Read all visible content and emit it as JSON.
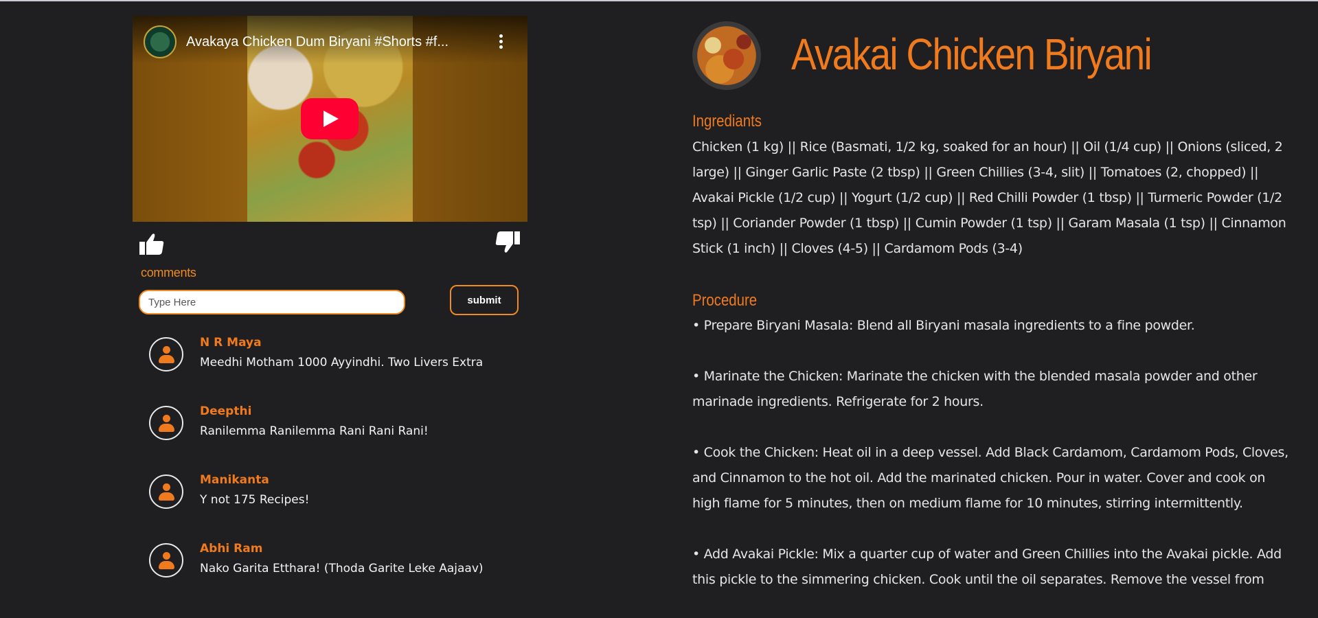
{
  "video": {
    "title": "Avakaya Chicken Dum Biryani #Shorts #f..."
  },
  "comments_section": {
    "label": "comments",
    "input_placeholder": "Type Here",
    "submit_label": "submit",
    "items": [
      {
        "name": "N R Maya",
        "text": "Meedhi Motham 1000 Ayyindhi. Two Livers Extra"
      },
      {
        "name": "Deepthi",
        "text": "Ranilemma Ranilemma Rani Rani Rani!"
      },
      {
        "name": "Manikanta",
        "text": "Y not 175 Recipes!"
      },
      {
        "name": "Abhi Ram",
        "text": "Nako Garita Etthara! (Thoda Garite Leke Aajaav)"
      }
    ]
  },
  "recipe": {
    "title": "Avakai Chicken Biryani",
    "ingredients_heading": "Ingrediants",
    "ingredients": "Chicken (1 kg) || Rice (Basmati, 1/2 kg, soaked for an hour) || Oil (1/4 cup) || Onions (sliced, 2 large) || Ginger Garlic Paste (2 tbsp) || Green Chillies (3-4, slit) || Tomatoes (2, chopped) || Avakai Pickle (1/2 cup) || Yogurt (1/2 cup) || Red Chilli Powder (1 tbsp) || Turmeric Powder (1/2 tsp) || Coriander Powder (1 tbsp) || Cumin Powder (1 tsp) || Garam Masala (1 tsp) || Cinnamon Stick (1 inch) || Cloves (4-5) || Cardamom Pods (3-4)",
    "procedure_heading": "Procedure",
    "steps": [
      "• Prepare Biryani Masala: Blend all Biryani masala ingredients to a fine powder.",
      "• Marinate the Chicken: Marinate the chicken with the blended masala powder and other marinade ingredients. Refrigerate for 2 hours.",
      "• Cook the Chicken: Heat oil in a deep vessel. Add Black Cardamom, Cardamom Pods, Cloves, and Cinnamon to the hot oil. Add the marinated chicken. Pour in water. Cover and cook on high flame for 5 minutes, then on medium flame for 10 minutes, stirring intermittently.",
      "• Add Avakai Pickle: Mix a quarter cup of water and Green Chillies into the Avakai pickle. Add this pickle to the simmering chicken. Cook until the oil separates. Remove the vessel from"
    ]
  },
  "icons": [
    "thumbs-up-icon",
    "thumbs-down-icon",
    "play-icon",
    "more-options-icon",
    "user-avatar-icon"
  ],
  "colors": {
    "accent": "#f07a1e",
    "background": "#1f1f21",
    "text": "#e9e9e9",
    "play": "#ff0033"
  }
}
